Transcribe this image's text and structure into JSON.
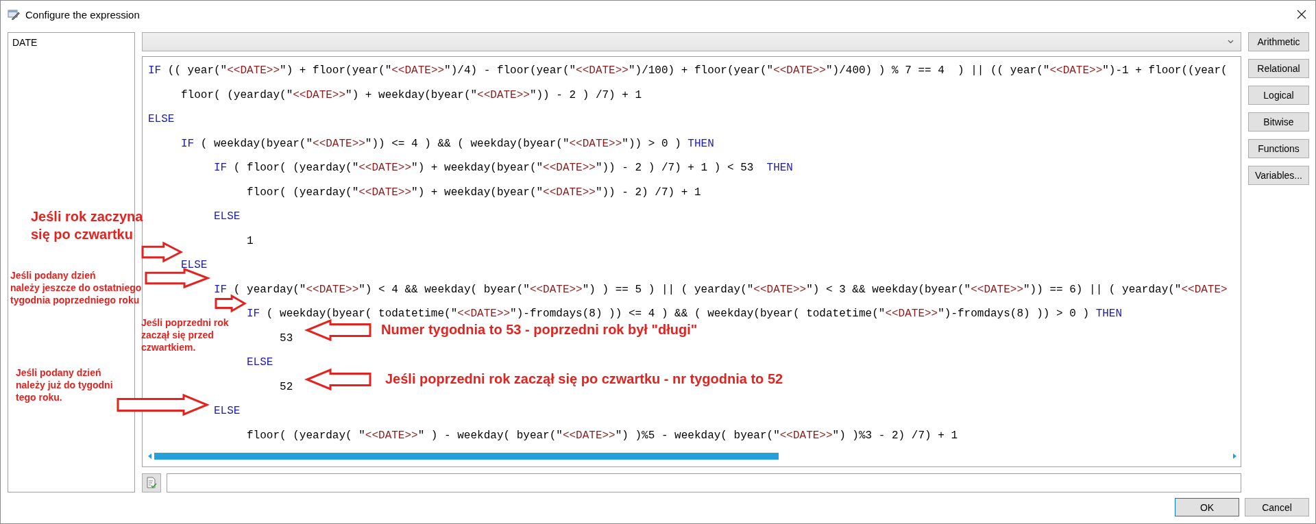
{
  "window": {
    "title": "Configure the expression"
  },
  "variables": [
    {
      "label": "DATE"
    }
  ],
  "code_lines": [
    {
      "tokens": [
        {
          "kind": "kw",
          "text": "IF"
        },
        {
          "kind": "plain",
          "text": " (( year(\""
        },
        {
          "kind": "str",
          "text": "<<DATE>>"
        },
        {
          "kind": "plain",
          "text": "\") + floor(year(\""
        },
        {
          "kind": "str",
          "text": "<<DATE>>"
        },
        {
          "kind": "plain",
          "text": "\")/4) - floor(year(\""
        },
        {
          "kind": "str",
          "text": "<<DATE>>"
        },
        {
          "kind": "plain",
          "text": "\")/100) + floor(year(\""
        },
        {
          "kind": "str",
          "text": "<<DATE>>"
        },
        {
          "kind": "plain",
          "text": "\")/400) ) % 7 == 4  ) || (( year(\""
        },
        {
          "kind": "str",
          "text": "<<DATE>>"
        },
        {
          "kind": "plain",
          "text": "\")-1 + floor((year("
        }
      ],
      "children": [
        {
          "tokens": [
            {
              "kind": "plain",
              "text": "floor( (yearday(\""
            },
            {
              "kind": "str",
              "text": "<<DATE>>"
            },
            {
              "kind": "plain",
              "text": "\") + weekday(byear(\""
            },
            {
              "kind": "str",
              "text": "<<DATE>>"
            },
            {
              "kind": "plain",
              "text": "\")) - 2 ) /7) + 1"
            }
          ]
        }
      ]
    },
    {
      "tokens": [
        {
          "kind": "kw",
          "text": "ELSE"
        }
      ],
      "children": [
        {
          "tokens": [
            {
              "kind": "kw",
              "text": "IF"
            },
            {
              "kind": "plain",
              "text": " ( weekday(byear(\""
            },
            {
              "kind": "str",
              "text": "<<DATE>>"
            },
            {
              "kind": "plain",
              "text": "\")) <= 4 ) && ( weekday(byear(\""
            },
            {
              "kind": "str",
              "text": "<<DATE>>"
            },
            {
              "kind": "plain",
              "text": "\")) > 0 ) "
            },
            {
              "kind": "kw",
              "text": "THEN"
            }
          ],
          "children": [
            {
              "tokens": [
                {
                  "kind": "kw",
                  "text": "IF"
                },
                {
                  "kind": "plain",
                  "text": " ( floor( (yearday(\""
                },
                {
                  "kind": "str",
                  "text": "<<DATE>>"
                },
                {
                  "kind": "plain",
                  "text": "\") + weekday(byear(\""
                },
                {
                  "kind": "str",
                  "text": "<<DATE>>"
                },
                {
                  "kind": "plain",
                  "text": "\")) - 2 ) /7) + 1 ) < 53  "
                },
                {
                  "kind": "kw",
                  "text": "THEN"
                }
              ],
              "children": [
                {
                  "tokens": [
                    {
                      "kind": "plain",
                      "text": "floor( (yearday(\""
                    },
                    {
                      "kind": "str",
                      "text": "<<DATE>>"
                    },
                    {
                      "kind": "plain",
                      "text": "\") + weekday(byear(\""
                    },
                    {
                      "kind": "str",
                      "text": "<<DATE>>"
                    },
                    {
                      "kind": "plain",
                      "text": "\")) - 2) /7) + 1"
                    }
                  ]
                }
              ]
            },
            {
              "tokens": [
                {
                  "kind": "kw",
                  "text": "ELSE"
                }
              ],
              "children": [
                {
                  "tokens": [
                    {
                      "kind": "plain",
                      "text": "1"
                    }
                  ]
                }
              ]
            }
          ]
        },
        {
          "tokens": [
            {
              "kind": "kw",
              "text": "ELSE"
            }
          ],
          "children": [
            {
              "tokens": [
                {
                  "kind": "kw",
                  "text": "IF"
                },
                {
                  "kind": "plain",
                  "text": " ( yearday(\""
                },
                {
                  "kind": "str",
                  "text": "<<DATE>>"
                },
                {
                  "kind": "plain",
                  "text": "\") < 4 && weekday( byear(\""
                },
                {
                  "kind": "str",
                  "text": "<<DATE>>"
                },
                {
                  "kind": "plain",
                  "text": "\") ) == 5 ) || ( yearday(\""
                },
                {
                  "kind": "str",
                  "text": "<<DATE>>"
                },
                {
                  "kind": "plain",
                  "text": "\") < 3 && weekday(byear(\""
                },
                {
                  "kind": "str",
                  "text": "<<DATE>>"
                },
                {
                  "kind": "plain",
                  "text": "\")) == 6) || ( yearday(\""
                },
                {
                  "kind": "str",
                  "text": "<<DATE>"
                }
              ],
              "children": [
                {
                  "tokens": [
                    {
                      "kind": "kw",
                      "text": "IF"
                    },
                    {
                      "kind": "plain",
                      "text": " ( weekday(byear( todatetime(\""
                    },
                    {
                      "kind": "str",
                      "text": "<<DATE>>"
                    },
                    {
                      "kind": "plain",
                      "text": "\")-fromdays(8) )) <= 4 ) && ( weekday(byear( todatetime(\""
                    },
                    {
                      "kind": "str",
                      "text": "<<DATE>>"
                    },
                    {
                      "kind": "plain",
                      "text": "\")-fromdays(8) )) > 0 ) "
                    },
                    {
                      "kind": "kw",
                      "text": "THEN"
                    }
                  ],
                  "children": [
                    {
                      "tokens": [
                        {
                          "kind": "plain",
                          "text": "53"
                        }
                      ]
                    }
                  ]
                },
                {
                  "tokens": [
                    {
                      "kind": "kw",
                      "text": "ELSE"
                    }
                  ],
                  "children": [
                    {
                      "tokens": [
                        {
                          "kind": "plain",
                          "text": "52"
                        }
                      ]
                    }
                  ]
                }
              ]
            },
            {
              "tokens": [
                {
                  "kind": "kw",
                  "text": "ELSE"
                }
              ],
              "children": [
                {
                  "tokens": [
                    {
                      "kind": "plain",
                      "text": "floor( (yearday( \""
                    },
                    {
                      "kind": "str",
                      "text": "<<DATE>>"
                    },
                    {
                      "kind": "plain",
                      "text": "\" ) - weekday( byear(\""
                    },
                    {
                      "kind": "str",
                      "text": "<<DATE>>"
                    },
                    {
                      "kind": "plain",
                      "text": "\") )%5 - weekday( byear(\""
                    },
                    {
                      "kind": "str",
                      "text": "<<DATE>>"
                    },
                    {
                      "kind": "plain",
                      "text": "\") )%3 - 2) /7) + 1"
                    }
                  ]
                }
              ]
            }
          ]
        }
      ]
    }
  ],
  "operator_buttons": [
    "Arithmetic",
    "Relational",
    "Logical",
    "Bitwise",
    "Functions",
    "Variables..."
  ],
  "buttons": [
    "OK",
    "Cancel"
  ],
  "annotations": [
    {
      "text": "Jeśli rok zaczyna\nsię po czwartku",
      "kind": "right"
    },
    {
      "text": "Jeśli podany dzień\nnależy jeszcze do ostatniego\ntygodnia poprzedniego roku",
      "kind": "right"
    },
    {
      "text": "Jeśli poprzedni rok\nzaczął się przed\nczwartkiem.",
      "kind": "right"
    },
    {
      "text": "Numer tygodnia to 53 - poprzedni rok był \"długi\"",
      "kind": "left"
    },
    {
      "text": "Jeśli podany dzień\nnależy już do tygodni\ntego roku.",
      "kind": "right"
    },
    {
      "text": "Jeśli poprzedni rok zaczął się po czwartku - nr tygodnia to 52",
      "kind": "left"
    }
  ]
}
